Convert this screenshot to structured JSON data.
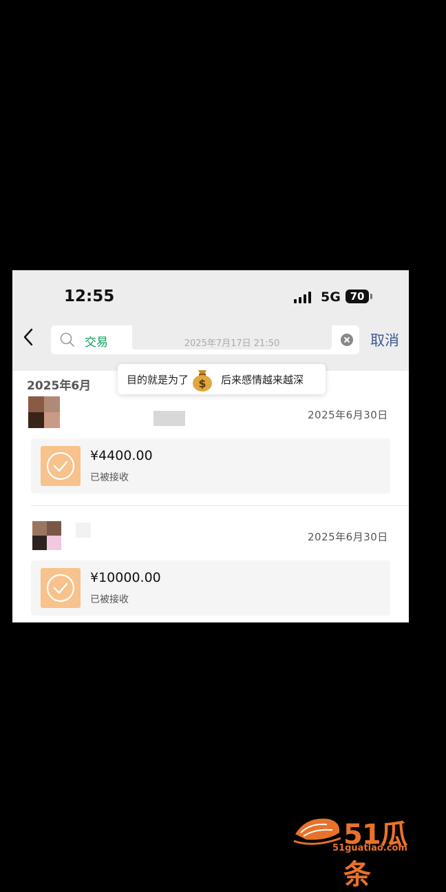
{
  "status_bar": {
    "time": "12:55",
    "network": "5G",
    "battery": "70"
  },
  "search": {
    "query": "交易",
    "cancel_label": "取消"
  },
  "timestamp_overlay": "2025年7月17日 21:50",
  "section_month": "2025年6月",
  "message_bubble": {
    "text_before": "目的就是为了",
    "text_after": "后来感情越来越深"
  },
  "transactions": [
    {
      "date": "2025年6月30日",
      "amount": "¥4400.00",
      "status": "已被接收"
    },
    {
      "date": "2025年6月30日",
      "amount": "¥10000.00",
      "status": "已被接收"
    }
  ],
  "watermark": {
    "brand": "51瓜条",
    "url": "51guatiao.com"
  },
  "colors": {
    "accent_green": "#07a15a",
    "cancel_blue": "#3d5b8f",
    "transfer_orange": "#f7c28c",
    "brand_orange": "#e8722a"
  }
}
